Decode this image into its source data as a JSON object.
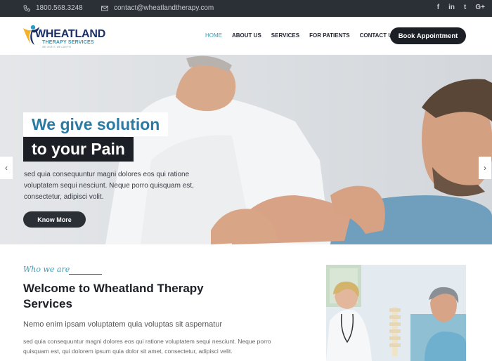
{
  "topbar": {
    "phone": "1800.568.3248",
    "email": "contact@wheatlandtherapy.com",
    "social": [
      "f",
      "in",
      "t",
      "G+"
    ]
  },
  "header": {
    "logo": {
      "name": "WHEATLAND",
      "sub": "THERAPY SERVICES",
      "tagline": "WE GIVE IT, WE CAN FIX"
    },
    "nav": [
      "HOME",
      "ABOUT US",
      "SERVICES",
      "FOR PATIENTS",
      "CONTACT US"
    ],
    "book_button": "Book Appointment"
  },
  "hero": {
    "title_line1": "We give solution",
    "title_line2": "to your Pain",
    "text": "sed quia consequuntur magni dolores eos qui ratione voluptatem sequi nesciunt. Neque porro quisquam est, consectetur, adipisci volit.",
    "button": "Know More",
    "prev_arrow": "‹",
    "next_arrow": "›"
  },
  "welcome": {
    "eyebrow": "Who we are",
    "title": "Welcome to Wheatland Therapy Services",
    "lead": "Nemo enim ipsam voluptatem quia voluptas sit aspernatur",
    "body": "sed quia consequuntur magni dolores eos qui ratione voluptatem sequi nesciunt. Neque porro quisquam est, qui dolorem ipsum quia dolor sit amet, consectetur, adipisci velit."
  },
  "colors": {
    "accent": "#3a9cb6",
    "dark": "#1c1f26",
    "topbar": "#2b2f36"
  }
}
